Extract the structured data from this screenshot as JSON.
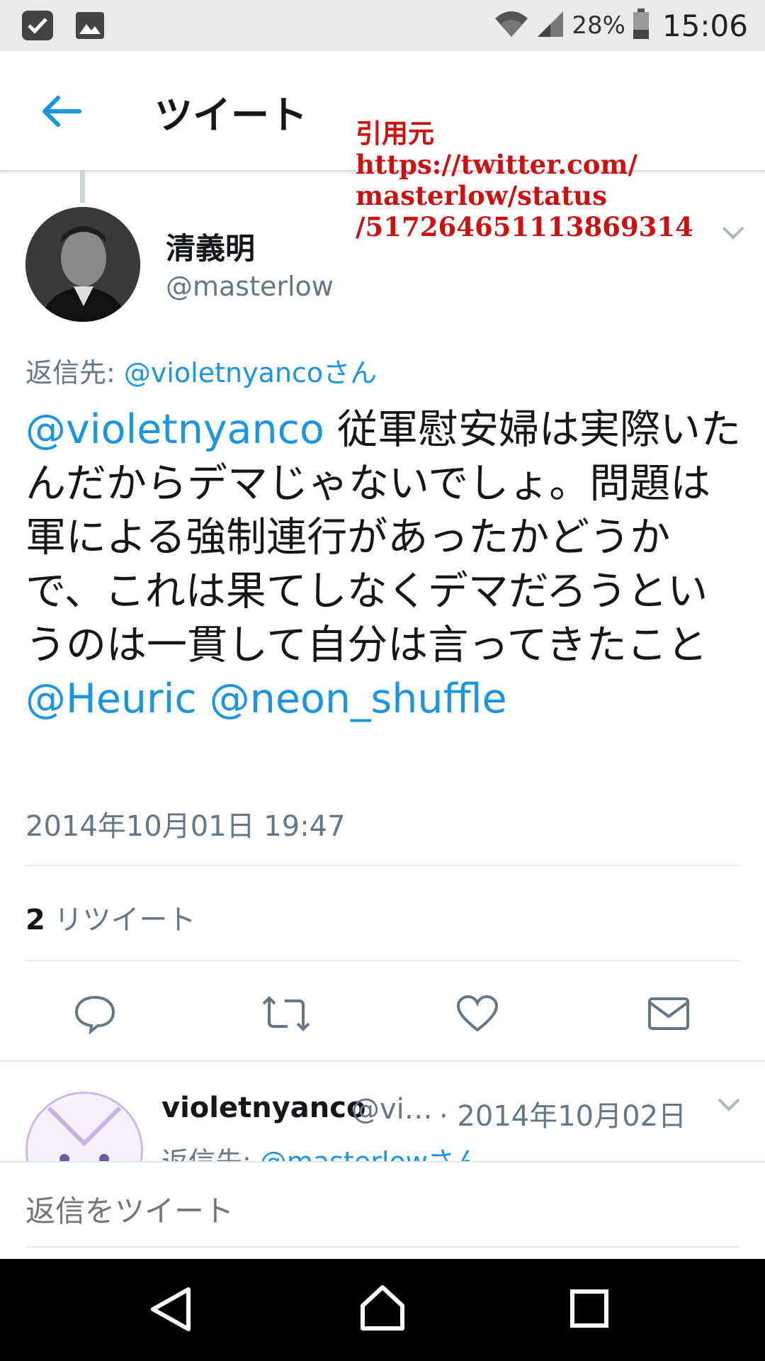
{
  "status_bar": {
    "battery": "28%",
    "time": "15:06"
  },
  "header": {
    "title": "ツイート"
  },
  "overlay_note": {
    "lines": [
      "引用元",
      "https://twitter.com/",
      "masterlow/status",
      "/517264651113869314"
    ]
  },
  "tweet": {
    "author_name": "清義明",
    "author_handle": "@masterlow",
    "reply_to_label": "返信先: ",
    "reply_to_user": "@violetnyancoさん",
    "mention_lead": "@violetnyanco",
    "text": " 従軍慰安婦は実際いたんだからデマじゃないでしょ。問題は軍による強制連行があったかどうかで、これは果てしなくデマだろうというのは一貫して自分は言ってきたこと ",
    "mention_1": "@Heuric",
    "mention_2": "@neon_shuffle",
    "datetime": "2014年10月01日 19:47",
    "retweet_count": "2",
    "retweet_label": " リツイート"
  },
  "reply": {
    "name": "violetnyanco",
    "handle": "@vi…",
    "date": "· 2014年10月02日",
    "reply_to_label": "返信先: ",
    "reply_to_user": "@masterlowさん"
  },
  "composer": {
    "placeholder": "返信をツイート"
  },
  "colors": {
    "link": "#1b95e0",
    "secondary": "#657786",
    "overlay": "#cc1111",
    "icon": "#657786"
  }
}
